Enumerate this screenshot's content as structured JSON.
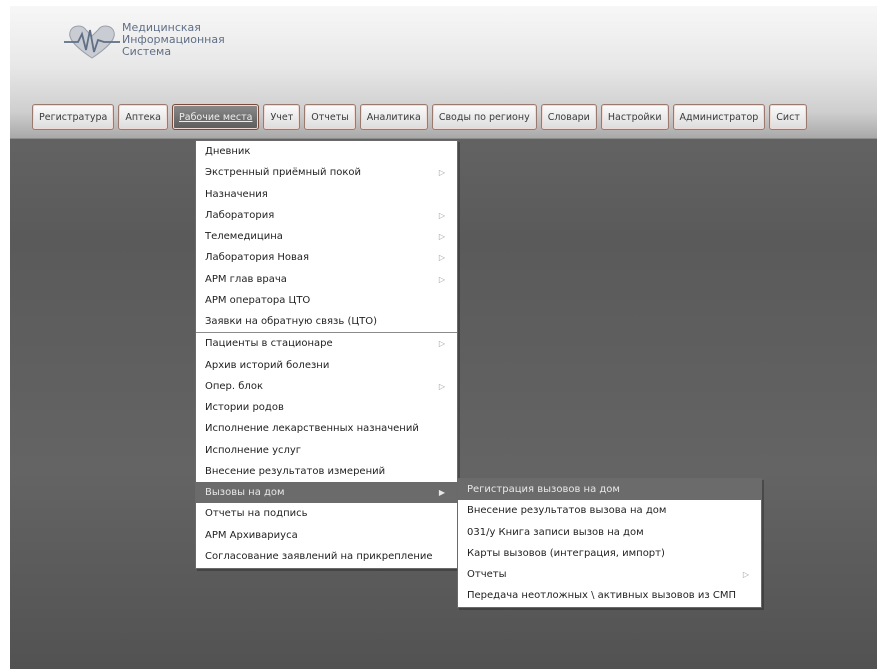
{
  "app": {
    "title_lines": [
      "Медицинская",
      "Информационная",
      "Система"
    ],
    "logo_icon": "heart-pulse-icon",
    "accent": "#5f6f86"
  },
  "nav": {
    "items": [
      {
        "label": "Регистратура"
      },
      {
        "label": "Аптека"
      },
      {
        "label": "Рабочие места"
      },
      {
        "label": "Учет"
      },
      {
        "label": "Отчеты"
      },
      {
        "label": "Аналитика"
      },
      {
        "label": "Своды по региону"
      },
      {
        "label": "Словари"
      },
      {
        "label": "Настройки"
      },
      {
        "label": "Администратор"
      },
      {
        "label": "Сист"
      }
    ],
    "active": "Рабочие места"
  },
  "menu": {
    "items": [
      {
        "label": "Дневник"
      },
      {
        "label": "Экстренный приёмный покой",
        "submenu_icon": "chevron-right-icon"
      },
      {
        "label": "Назначения"
      },
      {
        "label": "Лаборатория",
        "submenu_icon": "chevron-right-icon"
      },
      {
        "label": "Телемедицина",
        "submenu_icon": "chevron-right-icon"
      },
      {
        "label": "Лаборатория Новая",
        "submenu_icon": "chevron-right-icon"
      },
      {
        "label": "АРМ глав врача",
        "submenu_icon": "chevron-right-icon"
      },
      {
        "label": "АРМ оператора ЦТО"
      },
      {
        "label": "Заявки на обратную связь (ЦТО)"
      },
      {
        "label": "Пациенты в стационаре",
        "submenu_icon": "chevron-right-icon"
      },
      {
        "label": "Архив историй болезни"
      },
      {
        "label": "Опер. блок",
        "submenu_icon": "chevron-right-icon"
      },
      {
        "label": "Истории родов"
      },
      {
        "label": "Исполнение лекарственных назначений"
      },
      {
        "label": "Исполнение услуг"
      },
      {
        "label": "Внесение результатов измерений"
      },
      {
        "label": "Вызовы на дом",
        "submenu_icon": "chevron-right-icon"
      },
      {
        "label": "Отчеты на подпись"
      },
      {
        "label": "АРМ Архивариуса"
      },
      {
        "label": "Согласование заявлений на прикрепление"
      }
    ],
    "highlighted": "Вызовы на дом"
  },
  "submenu": {
    "items": [
      {
        "label": "Регистрация вызовов на дом"
      },
      {
        "label": "Внесение результатов вызова на дом"
      },
      {
        "label": "031/у Книга записи вызов на дом"
      },
      {
        "label": "Карты вызовов (интеграция, импорт)"
      },
      {
        "label": "Отчеты",
        "submenu_icon": "chevron-right-icon"
      },
      {
        "label": "Передача неотложных \\ активных вызовов из СМП"
      }
    ],
    "highlighted": "Регистрация вызовов на дом"
  }
}
